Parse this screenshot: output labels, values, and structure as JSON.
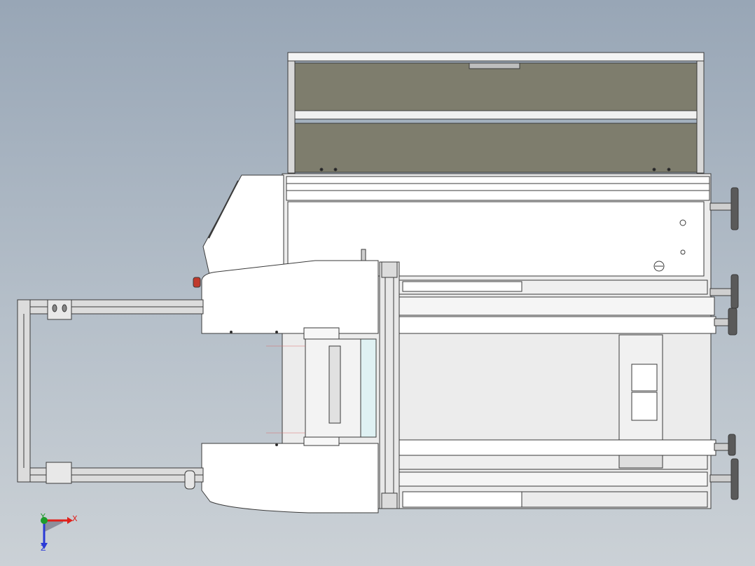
{
  "viewport": {
    "background_top": "#98a6b6",
    "background_bottom": "#cbd1d6"
  },
  "model": {
    "part_fill": "#ffffff",
    "edge_color": "#3a3a3a",
    "panel_fill": "#7e7d6d",
    "frame_fill": "#dcdcdc",
    "accent_red": "#c0392b",
    "knob_fill": "#5a5a5a"
  },
  "triad": {
    "x_label": "X",
    "y_label": "Y",
    "z_label": "Z",
    "x_color": "#e0201b",
    "y_color": "#1d9c2b",
    "z_color": "#2a3ad6"
  }
}
